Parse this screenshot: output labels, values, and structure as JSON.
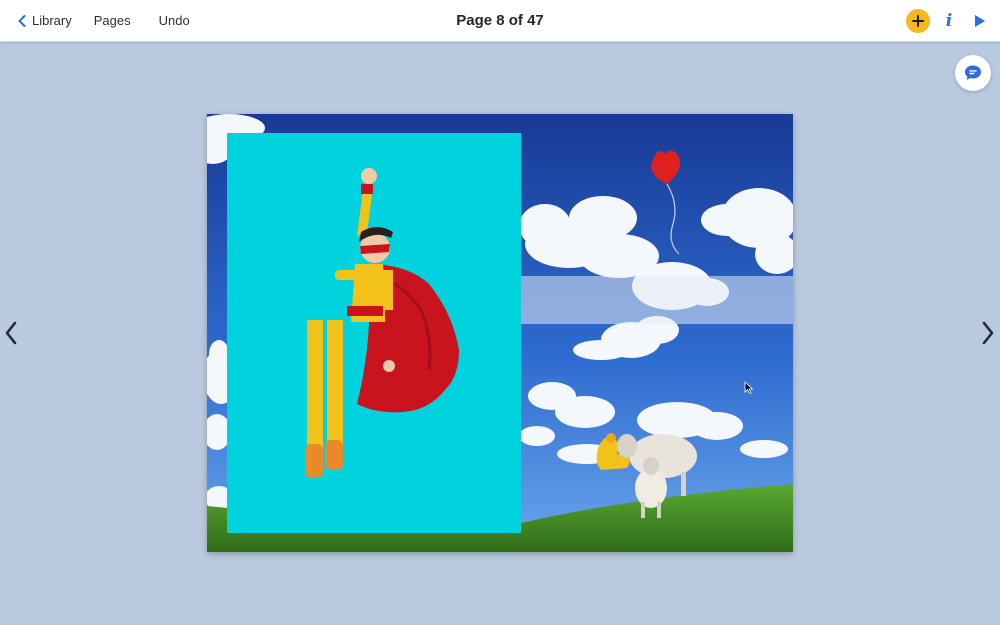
{
  "toolbar": {
    "back_label": "Library",
    "pages_label": "Pages",
    "undo_label": "Undo",
    "page_indicator": "Page 8 of 47",
    "icons": {
      "back": "chevron-left-icon",
      "add": "plus-icon",
      "info": "info-icon",
      "play": "play-icon"
    },
    "info_glyph": "i"
  },
  "colors": {
    "background": "#b9c9df",
    "accent_blue": "#2a6de0",
    "add_button": "#f6b81c",
    "sky_top": "#1a3f9c",
    "frame_cyan": "#00d2de",
    "grass": "#4d9a2a"
  },
  "page": {
    "elements": [
      "sky-cloud-photo",
      "cyan-frame",
      "superhero-kid",
      "heart-balloon",
      "sheep",
      "flexed-arm-sticker"
    ]
  }
}
